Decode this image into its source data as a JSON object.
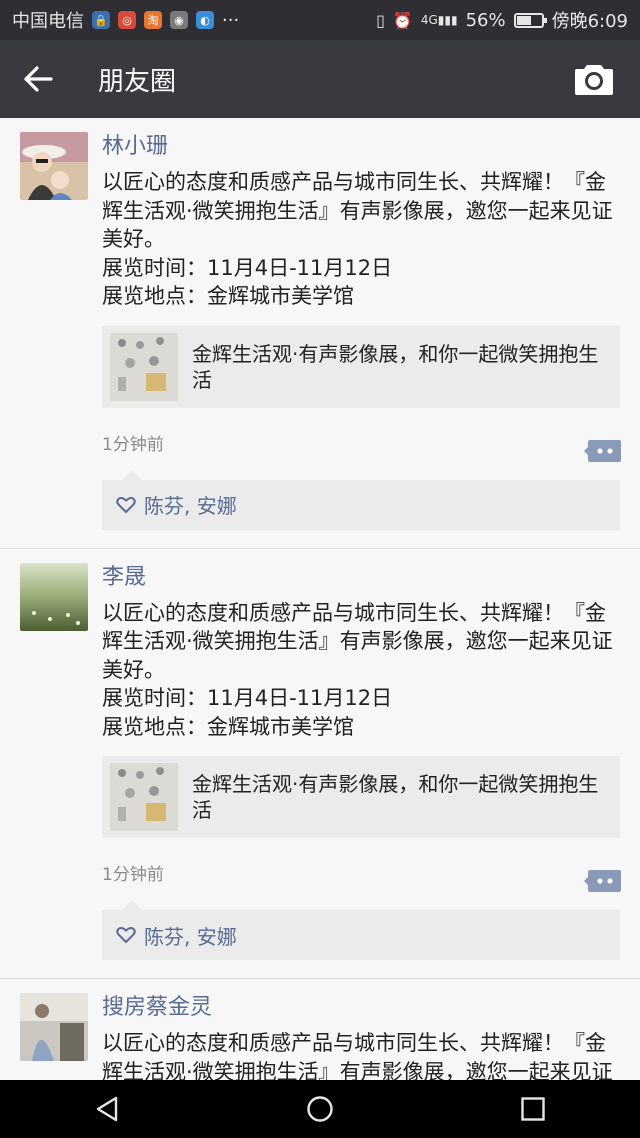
{
  "status_bar": {
    "carrier": "中国电信",
    "ellipsis": "···",
    "battery_percent": "56%",
    "battery_level": 0.56,
    "time": "傍晚6:09",
    "network": "4G"
  },
  "header": {
    "title": "朋友圈",
    "back_icon": "arrow-left-icon",
    "camera_icon": "camera-icon"
  },
  "posts": [
    {
      "author": "林小珊",
      "text": "以匠心的态度和质感产品与城市同生长、共辉耀！『金辉生活观·微笑拥抱生活』有声影像展，邀您一起来见证美好。\n展览时间：11月4日-11月12日\n展览地点：金辉城市美学馆",
      "link_title": "金辉生活观·有声影像展，和你一起微笑拥抱生活",
      "time": "1分钟前",
      "likes": "陈芬, 安娜"
    },
    {
      "author": "李晟",
      "text": "以匠心的态度和质感产品与城市同生长、共辉耀！『金辉生活观·微笑拥抱生活』有声影像展，邀您一起来见证美好。\n展览时间：11月4日-11月12日\n展览地点：金辉城市美学馆",
      "link_title": "金辉生活观·有声影像展，和你一起微笑拥抱生活",
      "time": "1分钟前",
      "likes": "陈芬, 安娜"
    },
    {
      "author": "搜房蔡金灵",
      "text": "以匠心的态度和质感产品与城市同生长、共辉耀！『金辉生活观·微笑拥抱生活』有声影像展，邀您一起来见证美好。"
    }
  ],
  "colors": {
    "name": "#576b95",
    "header_bg": "#393a3f",
    "status_bg": "#2f2f33",
    "card_bg": "#ebebeb"
  }
}
